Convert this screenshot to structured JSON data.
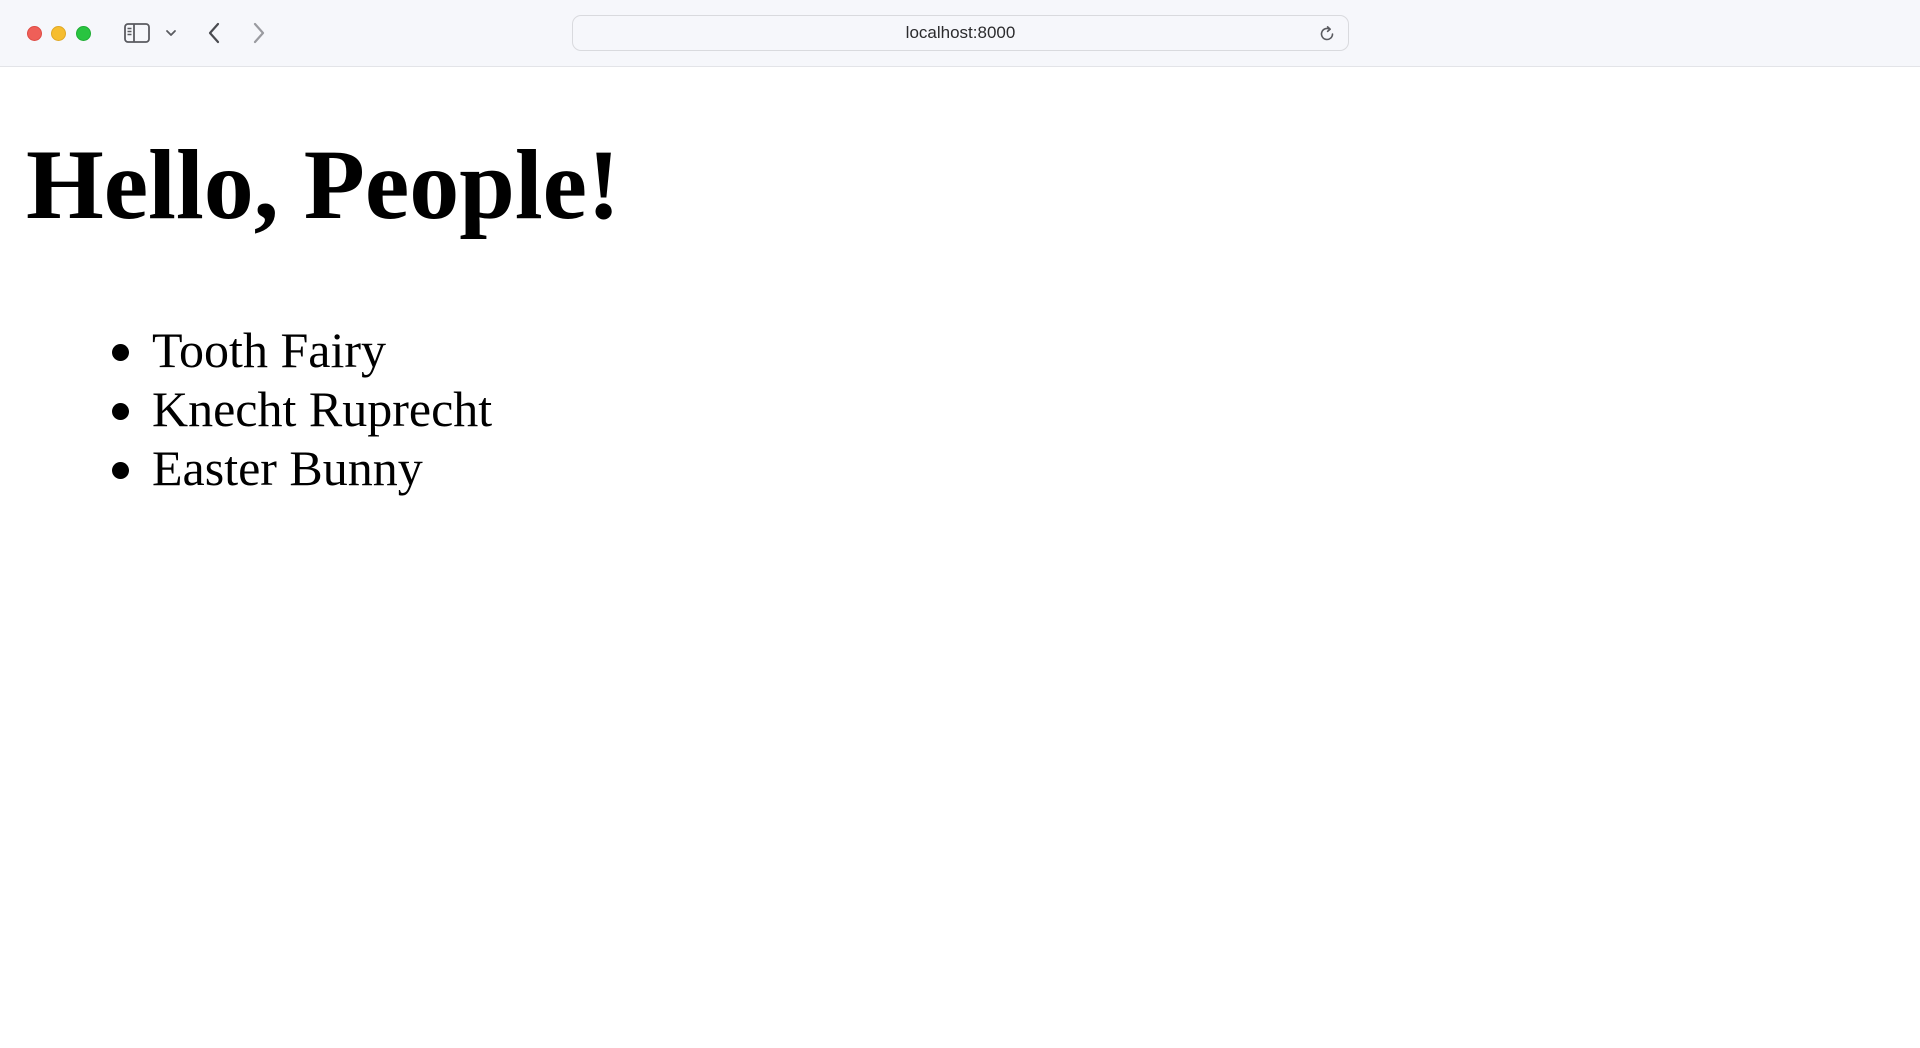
{
  "browser": {
    "address": "localhost:8000",
    "colors": {
      "close": "#ef5f58",
      "minimize": "#f6bd2f",
      "maximize": "#29c440"
    },
    "icons": {
      "sidebar": "sidebar-icon",
      "sidebar_menu": "chevron-down-icon",
      "back": "chevron-left-icon",
      "forward": "chevron-right-icon",
      "reload": "reload-icon"
    }
  },
  "page": {
    "heading": "Hello, People!",
    "people": [
      "Tooth Fairy",
      "Knecht Ruprecht",
      "Easter Bunny"
    ]
  }
}
